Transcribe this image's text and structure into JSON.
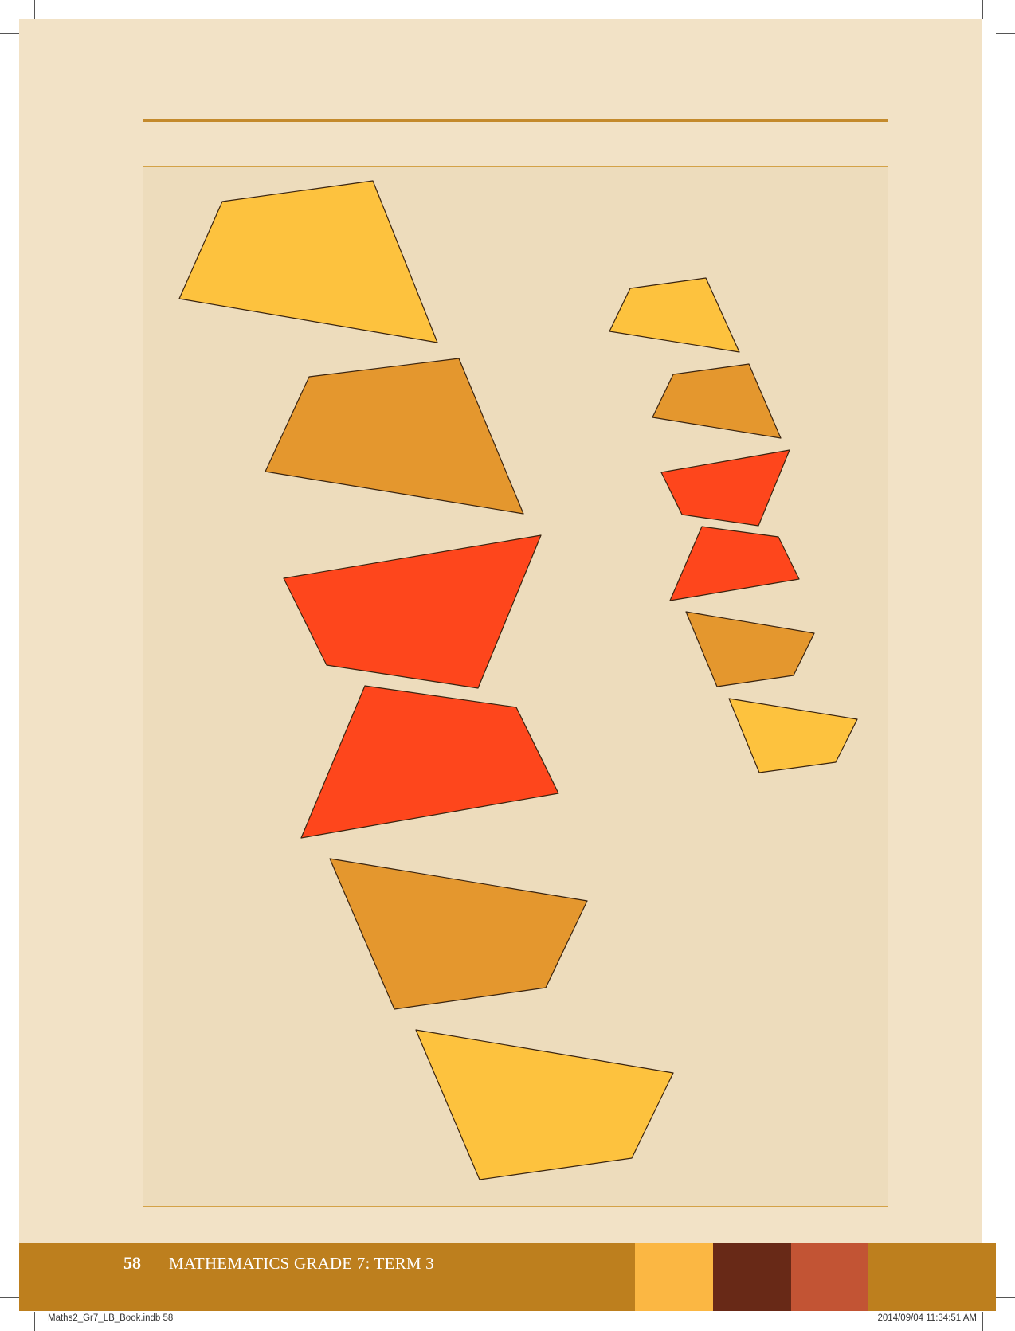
{
  "footer": {
    "page_number": "58",
    "running_title": "MATHEMATICS GRADE 7: TERM 3",
    "swatch_colors": [
      "#fbb743",
      "#682917",
      "#c25434"
    ]
  },
  "slug": {
    "file": "Maths2_Gr7_LB_Book.indb   58",
    "timestamp": "2014/09/04   11:34:51 AM"
  },
  "figure": {
    "description_colors": {
      "yellow": "#fdc23e",
      "orange": "#e4972e",
      "red": "#fe461c"
    }
  }
}
